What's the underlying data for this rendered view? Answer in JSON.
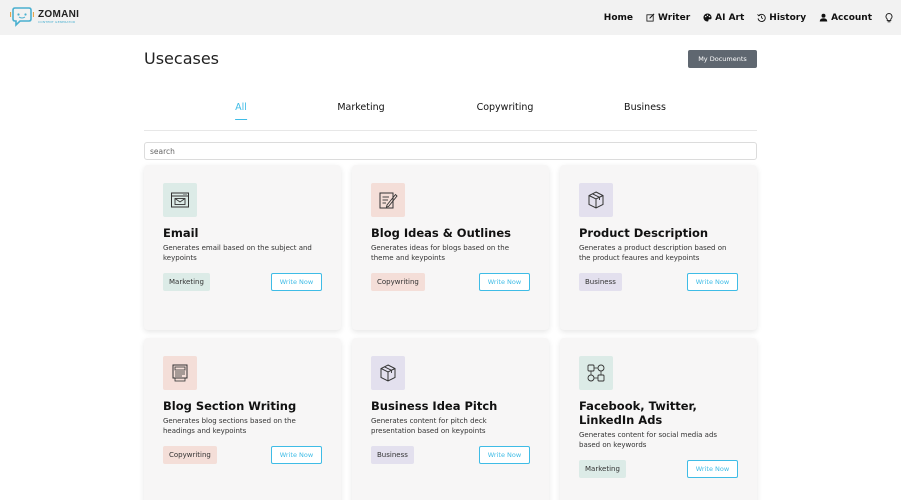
{
  "brand": {
    "name": "ZOMANI",
    "tagline": "CONTENT GENERATOR"
  },
  "nav": [
    {
      "label": "Home",
      "icon": ""
    },
    {
      "label": "Writer",
      "icon": "edit-icon"
    },
    {
      "label": "AI Art",
      "icon": "palette-icon"
    },
    {
      "label": "History",
      "icon": "history-icon"
    },
    {
      "label": "Account",
      "icon": "user-icon"
    },
    {
      "label": "",
      "icon": "lightbulb-icon"
    }
  ],
  "page": {
    "title": "Usecases",
    "my_documents": "My Documents"
  },
  "tabs": [
    {
      "label": "All",
      "active": true
    },
    {
      "label": "Marketing",
      "active": false
    },
    {
      "label": "Copywriting",
      "active": false
    },
    {
      "label": "Business",
      "active": false
    }
  ],
  "search": {
    "placeholder": "search",
    "value": ""
  },
  "cards": [
    {
      "icon": "email-icon",
      "title": "Email",
      "description": "Generates email based on the subject and keypoints",
      "tag": "Marketing",
      "button": "Write Now"
    },
    {
      "icon": "blog-ideas-icon",
      "title": "Blog Ideas & Outlines",
      "description": "Generates ideas for blogs based on the theme and keypoints",
      "tag": "Copywriting",
      "button": "Write Now"
    },
    {
      "icon": "product-box-icon",
      "title": "Product Description",
      "description": "Generates a product description based on the product feaures and keypoints",
      "tag": "Business",
      "button": "Write Now"
    },
    {
      "icon": "blog-section-icon",
      "title": "Blog Section Writing",
      "description": "Generates blog sections based on the headings and keypoints",
      "tag": "Copywriting",
      "button": "Write Now"
    },
    {
      "icon": "product-box-icon",
      "title": "Business Idea Pitch",
      "description": "Generates content for pitch deck presentation based on keypoints",
      "tag": "Business",
      "button": "Write Now"
    },
    {
      "icon": "social-media-icon",
      "title": "Facebook, Twitter, LinkedIn Ads",
      "description": "Generates content for social media ads based on keywords",
      "tag": "Marketing",
      "button": "Write Now"
    }
  ],
  "colors": {
    "accent": "#3fbce6",
    "nav_bg": "#f2f2f2",
    "dark_button": "#5f6770",
    "tag_marketing": "#dcebe7",
    "tag_copywriting": "#f4ded8",
    "tag_business": "#e3e0ee"
  }
}
